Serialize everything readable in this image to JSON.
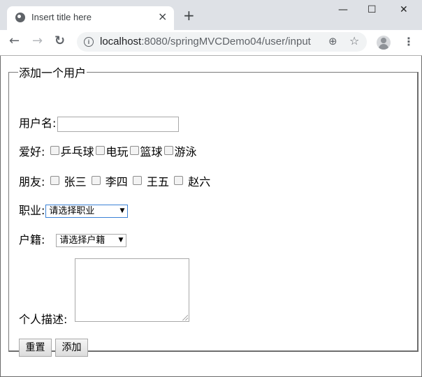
{
  "browser": {
    "tab_title": "Insert title here",
    "tab_close": "×",
    "new_tab": "+",
    "window_controls": {
      "minimize": "—",
      "maximize": "☐",
      "close": "✕"
    },
    "nav": {
      "back": "←",
      "forward": "→",
      "reload": "↻"
    },
    "url_host": "localhost",
    "url_path": ":8080/springMVCDemo04/user/input",
    "icons": {
      "info": "i",
      "zoom": "⊕",
      "star": "☆",
      "menu": "⋮"
    }
  },
  "form": {
    "legend": "添加一个用户",
    "username": {
      "label": "用户名:",
      "value": ""
    },
    "hobbies": {
      "label": "爱好:",
      "options": [
        "乒乓球",
        "电玩",
        "篮球",
        "游泳"
      ]
    },
    "friends": {
      "label": "朋友:",
      "options": [
        "张三",
        "李四",
        "王五",
        "赵六"
      ]
    },
    "job": {
      "label": "职业:",
      "selected": "请选择职业"
    },
    "hometown": {
      "label": "户籍:",
      "selected": "请选择户籍"
    },
    "description": {
      "label": "个人描述:",
      "value": ""
    },
    "buttons": {
      "reset": "重置",
      "submit": "添加"
    }
  }
}
